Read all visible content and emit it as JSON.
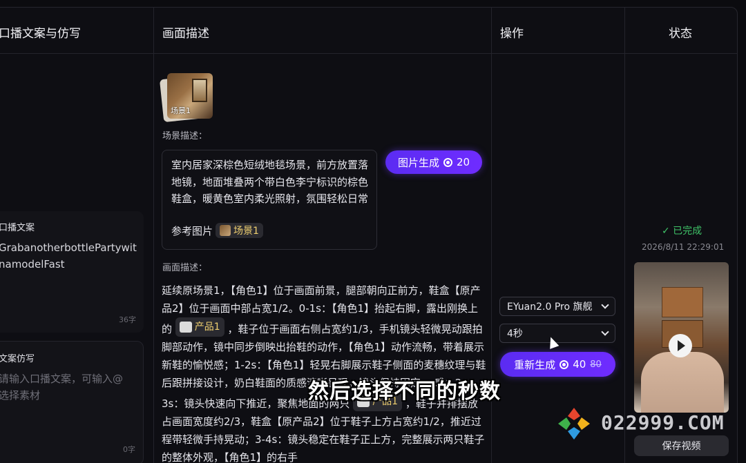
{
  "headers": {
    "col1": "口播文案与仿写",
    "col2": "画面描述",
    "col3": "操作",
    "col4": "状态"
  },
  "col1": {
    "card1_title": "口播文案",
    "card1_text_line1": "GrabanotherbottlePartywit",
    "card1_text_line2": "namodelFast",
    "card1_count": "36字",
    "card2_title": "文案仿写",
    "card2_placeholder_line1": "请输入口播文案，可输入@",
    "card2_placeholder_line2": "选择素材",
    "card2_count": "0字"
  },
  "col2": {
    "thumb_label": "场景1",
    "scene_label": "场景描述：",
    "scene_text": "室内居家深棕色短绒地毯场景，前方放置落地镜，地面堆叠两个带白色李宁标识的棕色鞋盒，暖黄色室内柔光照射，氛围轻松日常",
    "ref_label": "参考图片",
    "ref_chip": "场景1",
    "image_gen_button": "图片生成",
    "image_gen_cost": "20",
    "desc_label": "画面描述：",
    "desc_p1": "延续原场景1，【角色1】位于画面前景，腿部朝向正前方，鞋盒【原产品2】位于画面中部占宽1/2。0-1s：【角色1】抬起右脚，露出刚换上的",
    "desc_chip1": "产品1",
    "desc_p2": "，鞋子位于画面右侧占宽约1/3，手机镜头轻微晃动跟拍脚部动作，镜中同步倒映出抬鞋的动作，【角色1】动作流畅，带着展示新鞋的愉悦感；1-2s：【角色1】轻晃右脚展示鞋子侧面的麦穗纹理与鞋后跟拼接设计，奶白鞋面的质感清晰呈现，镜头保持固定，",
    "desc_p3": "感；2-3s：镜头快速向下推近，聚焦地面的两只",
    "desc_chip2": "产品1",
    "desc_p4": "，鞋子并排摆放占画面宽度约2/3，鞋盒【原产品2】位于鞋子上方占宽约1/2，推近过程带轻微手持晃动；3-4s：镜头稳定在鞋子正上方，完整展示两只鞋子的整体外观，【角色1】的右手"
  },
  "col3": {
    "model_select": "EYuan2.0 Pro 旗舰",
    "duration_select": "4秒",
    "regen_button": "重新生成",
    "regen_cost": "40",
    "regen_old_cost": "80"
  },
  "col4": {
    "status": "✓ 已完成",
    "timestamp": "2026/8/11 22:29:01",
    "save_button": "保存视频"
  },
  "overlay": {
    "subtitle": "然后选择不同的秒数",
    "watermark": "022999.COM"
  },
  "colors": {
    "accent": "#6f2cff",
    "success": "#3fc468",
    "background": "#0b0b0f"
  }
}
